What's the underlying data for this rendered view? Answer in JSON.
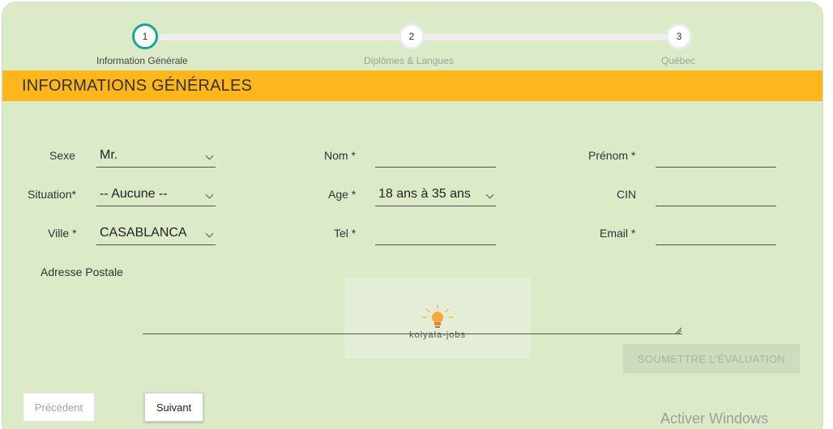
{
  "stepper": {
    "steps": [
      {
        "number": "1",
        "label": "Information Générale"
      },
      {
        "number": "2",
        "label": "Diplômes & Langues"
      },
      {
        "number": "3",
        "label": "Québec"
      }
    ]
  },
  "section": {
    "title": "INFORMATIONS GÉNÉRALES"
  },
  "form": {
    "sexe": {
      "label": "Sexe",
      "value": "Mr."
    },
    "situation": {
      "label": "Situation*",
      "value": "-- Aucune --"
    },
    "ville": {
      "label": "Ville *",
      "value": "CASABLANCA"
    },
    "nom": {
      "label": "Nom *",
      "value": ""
    },
    "age": {
      "label": "Age *",
      "value": "18 ans à 35 ans"
    },
    "tel": {
      "label": "Tel *",
      "value": ""
    },
    "prenom": {
      "label": "Prénom *",
      "value": ""
    },
    "cin": {
      "label": "CIN",
      "value": ""
    },
    "email": {
      "label": "Email *",
      "value": ""
    },
    "adresse": {
      "label": "Adresse Postale",
      "value": ""
    }
  },
  "watermark": {
    "text": "kolyala-jobs"
  },
  "buttons": {
    "submit": "SOUMETTRE L'ÉVALUATION",
    "previous": "Précédent",
    "next": "Suivant"
  },
  "overlay": {
    "activate_windows": "Activer Windows"
  },
  "colors": {
    "background": "#dbebc8",
    "section_bar": "#fdb71d",
    "active_step": "#1aa59a"
  }
}
